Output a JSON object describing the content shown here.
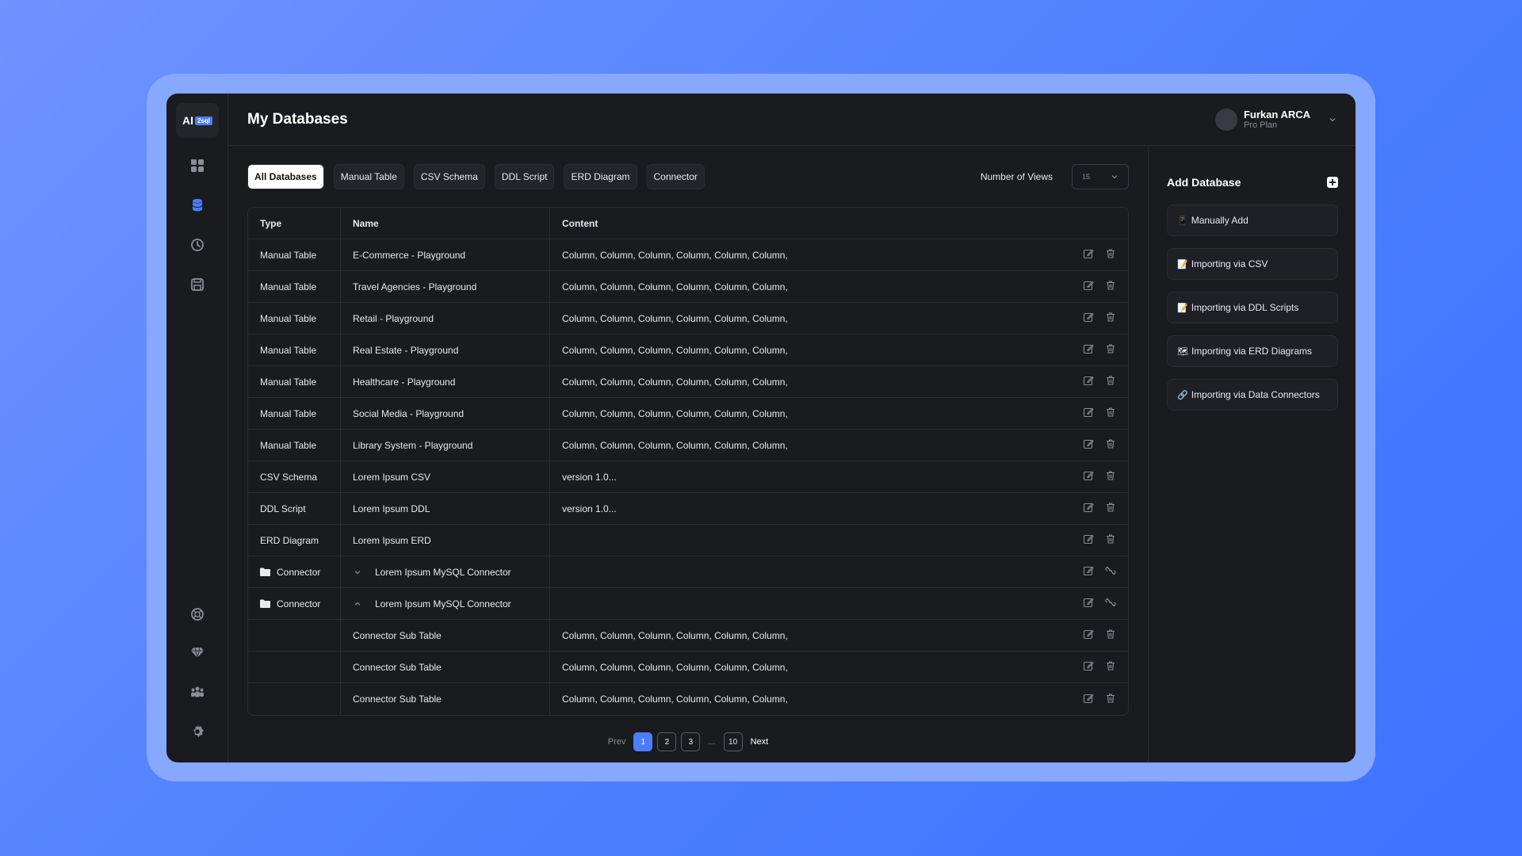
{
  "app": {
    "logo_text": "AI",
    "logo_tag": "2sql",
    "page_title": "My Databases"
  },
  "user": {
    "name": "Furkan ARCA",
    "plan": "Pro Plan"
  },
  "sidebar": {
    "top_icons": [
      "grid-icon",
      "database-icon",
      "history-icon",
      "save-icon"
    ],
    "bottom_icons": [
      "help-icon",
      "diamond-icon",
      "team-icon",
      "settings-icon"
    ]
  },
  "filters": {
    "tabs": [
      "All Databases",
      "Manual Table",
      "CSV Schema",
      "DDL Script",
      "ERD Diagram",
      "Connector"
    ],
    "active": 0,
    "views_label": "Number of Views",
    "views_value": "15"
  },
  "table": {
    "headers": [
      "Type",
      "Name",
      "Content"
    ],
    "rows": [
      {
        "type": "Manual Table",
        "name": "E-Commerce - Playground",
        "content": "Column, Column, Column, Column, Column, Column,",
        "action2": "trash"
      },
      {
        "type": "Manual Table",
        "name": "Travel Agencies - Playground",
        "content": "Column, Column, Column, Column, Column, Column,",
        "action2": "trash"
      },
      {
        "type": "Manual Table",
        "name": "Retail - Playground",
        "content": "Column, Column, Column, Column, Column, Column,",
        "action2": "trash"
      },
      {
        "type": "Manual Table",
        "name": "Real Estate - Playground",
        "content": "Column, Column, Column, Column, Column, Column,",
        "action2": "trash"
      },
      {
        "type": "Manual Table",
        "name": "Healthcare - Playground",
        "content": "Column, Column, Column, Column, Column, Column,",
        "action2": "trash"
      },
      {
        "type": "Manual Table",
        "name": "Social Media - Playground",
        "content": "Column, Column, Column, Column, Column, Column,",
        "action2": "trash"
      },
      {
        "type": "Manual Table",
        "name": "Library System - Playground",
        "content": "Column, Column, Column, Column, Column, Column,",
        "action2": "trash"
      },
      {
        "type": "CSV Schema",
        "name": "Lorem Ipsum CSV",
        "content": "version 1.0...",
        "action2": "trash"
      },
      {
        "type": "DDL Script",
        "name": "Lorem Ipsum DDL",
        "content": "version 1.0...",
        "action2": "trash"
      },
      {
        "type": "ERD Diagram",
        "name": "Lorem Ipsum ERD",
        "content": "",
        "action2": "trash"
      },
      {
        "type": "Connector",
        "name": "Lorem Ipsum MySQL Connector",
        "content": "",
        "folder": true,
        "chevron": "down",
        "action2": "unlink"
      },
      {
        "type": "Connector",
        "name": "Lorem Ipsum MySQL Connector",
        "content": "",
        "folder": true,
        "chevron": "up",
        "action2": "unlink"
      },
      {
        "type": "",
        "name": "Connector Sub Table",
        "content": "Column, Column, Column, Column, Column, Column,",
        "action2": "trash"
      },
      {
        "type": "",
        "name": "Connector Sub Table",
        "content": "Column, Column, Column, Column, Column, Column,",
        "action2": "trash"
      },
      {
        "type": "",
        "name": "Connector Sub Table",
        "content": "Column, Column, Column, Column, Column, Column,",
        "action2": "trash"
      }
    ]
  },
  "pagination": {
    "prev": "Prev",
    "pages": [
      "1",
      "2",
      "3"
    ],
    "ellipsis": "...",
    "last": "10",
    "next": "Next",
    "active": "1"
  },
  "add_database": {
    "title": "Add Database",
    "items": [
      {
        "emoji": "📱",
        "label": "Manually Add"
      },
      {
        "emoji": "📝",
        "label": "Importing via CSV"
      },
      {
        "emoji": "📝",
        "label": "Importing via DDL Scripts"
      },
      {
        "emoji": "🗺",
        "label": "Importing via ERD Diagrams"
      },
      {
        "emoji": "🔗",
        "label": "Importing via Data Connectors"
      }
    ]
  },
  "colors": {
    "accent": "#4c7dff",
    "bg": "#1a1b1f",
    "page_bg": "#4a7dff"
  }
}
